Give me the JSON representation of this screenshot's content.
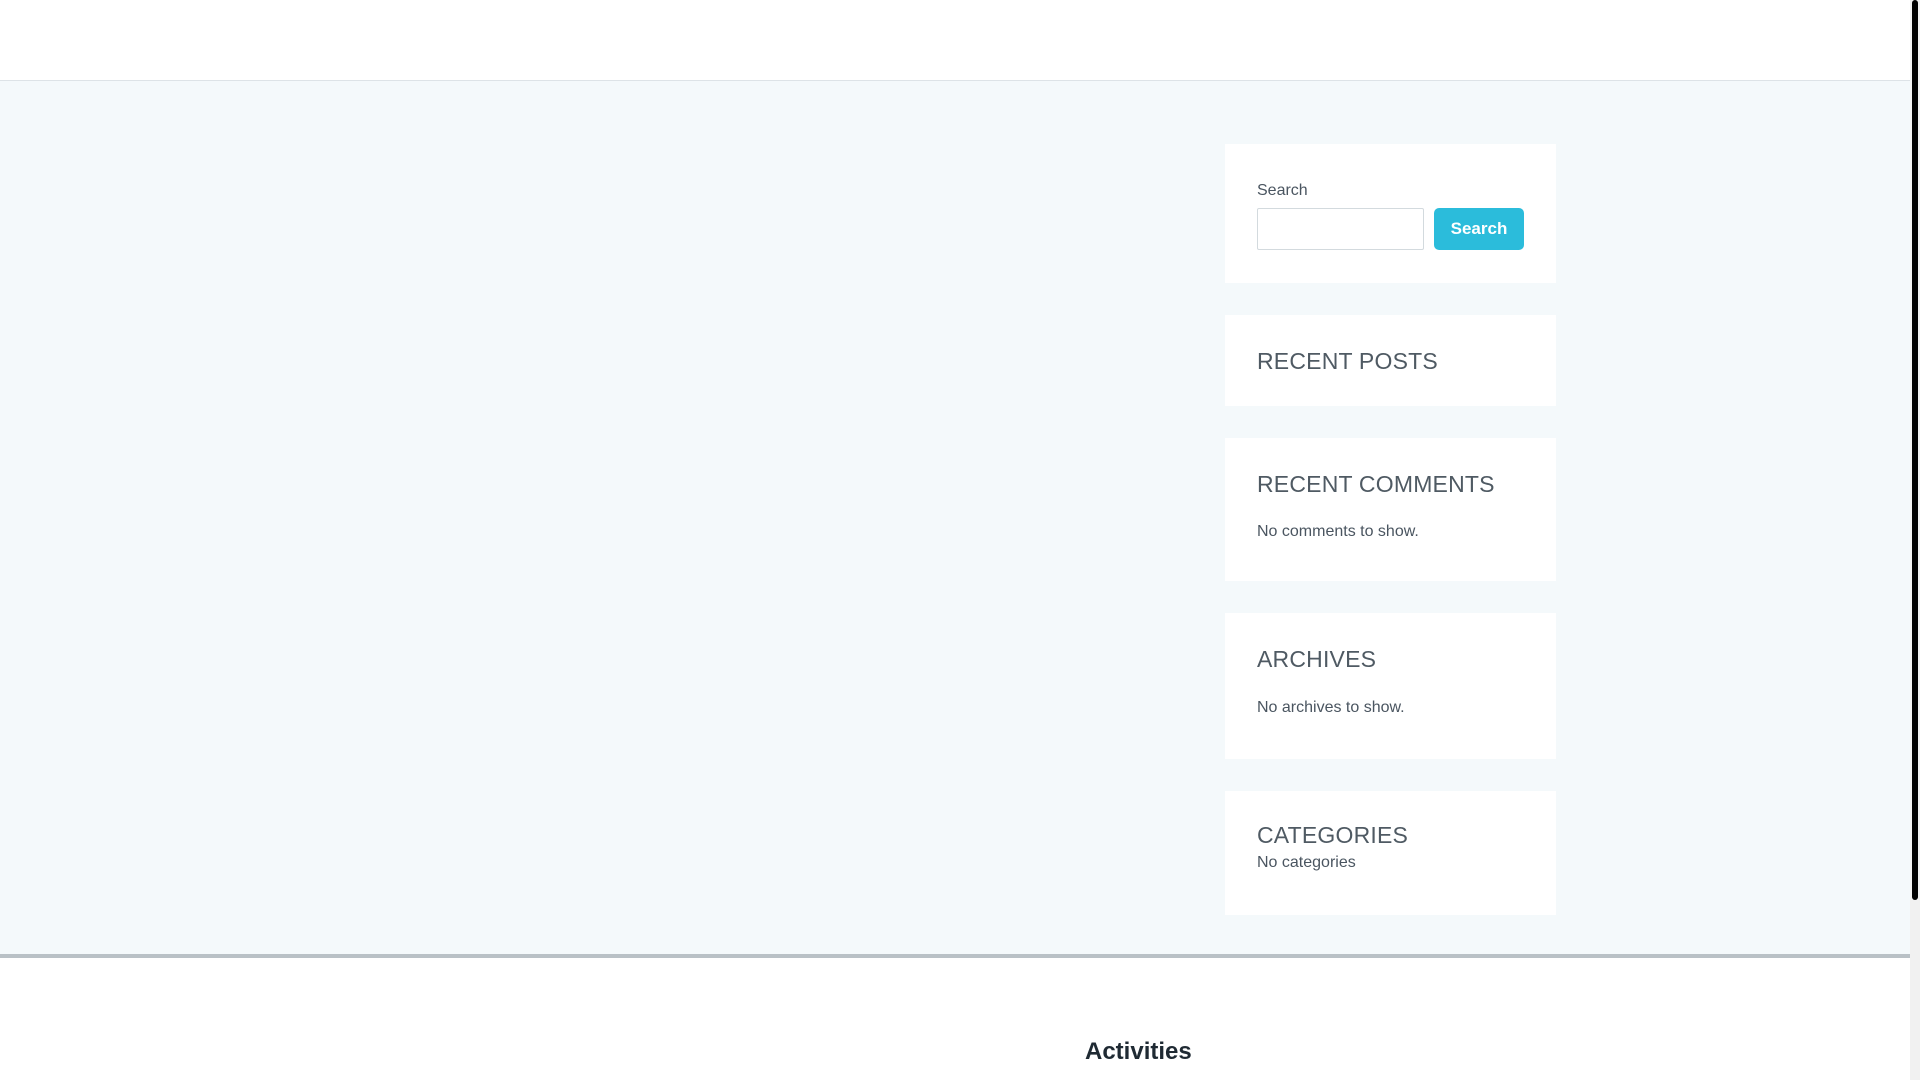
{
  "sidebar": {
    "search": {
      "label": "Search",
      "input_value": "",
      "input_placeholder": "",
      "button_label": "Search"
    },
    "recent_posts": {
      "title": "RECENT POSTS"
    },
    "recent_comments": {
      "title": "RECENT COMMENTS",
      "empty_text": "No comments to show."
    },
    "archives": {
      "title": "ARCHIVES",
      "empty_text": "No archives to show."
    },
    "categories": {
      "title": "CATEGORIES",
      "empty_text": "No categories"
    }
  },
  "footer": {
    "heading": "Activities"
  },
  "colors": {
    "accent": "#2bbcdb",
    "content_background": "#f4f9fb",
    "widget_background": "#ffffff",
    "text": "#4a5560",
    "heading_dark": "#1f2a33"
  }
}
